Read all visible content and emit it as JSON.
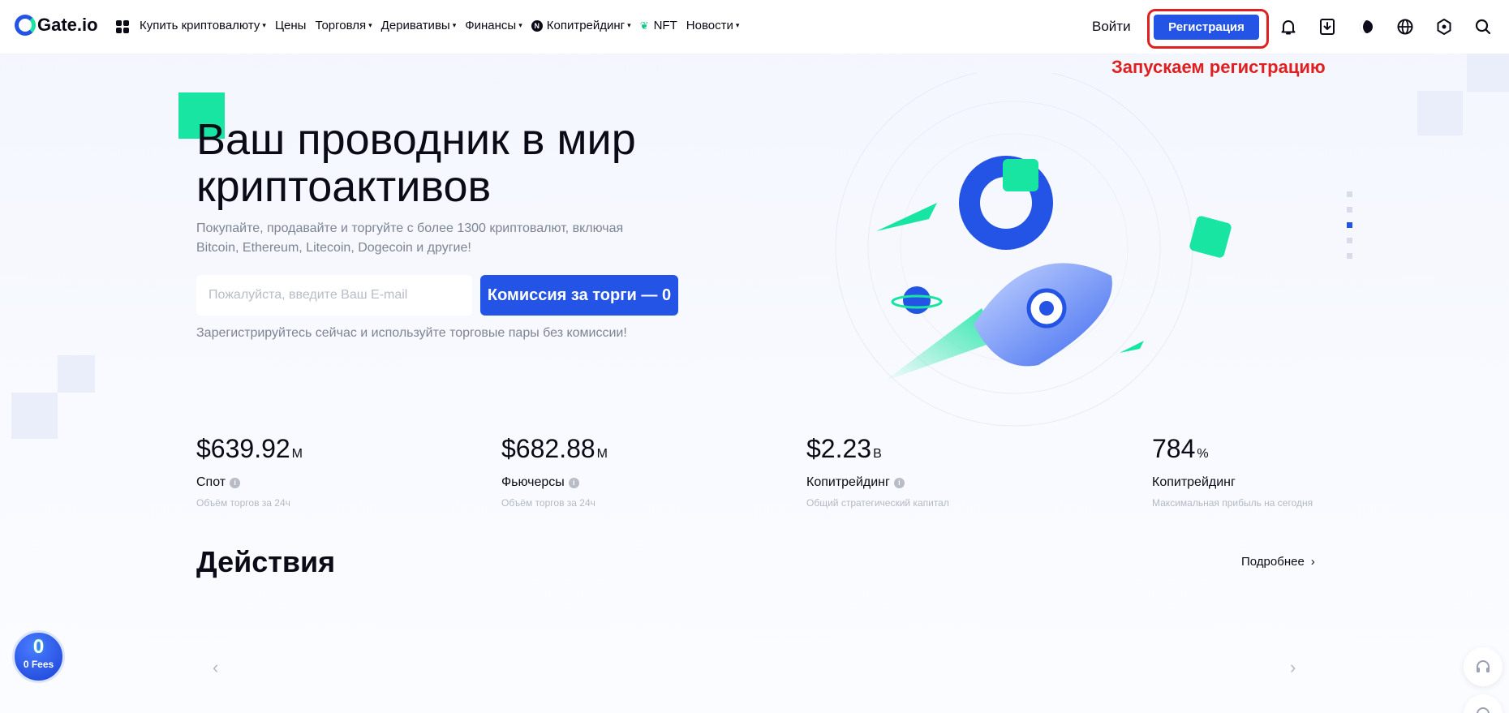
{
  "nav": {
    "logo": "Gate.io",
    "menu": [
      {
        "label": "Купить криптовалюту",
        "dropdown": true
      },
      {
        "label": "Цены",
        "dropdown": false
      },
      {
        "label": "Торговля",
        "dropdown": true
      },
      {
        "label": "Деривативы",
        "dropdown": true
      },
      {
        "label": "Финансы",
        "dropdown": true
      },
      {
        "label": "Копитрейдинг",
        "dropdown": true,
        "icon": "copy-trading-icon"
      },
      {
        "label": "NFT",
        "dropdown": false,
        "icon": "leaf-icon"
      },
      {
        "label": "Новости",
        "dropdown": true
      }
    ],
    "caret": "▾",
    "login": "Войти",
    "register": "Регистрация",
    "icons": [
      "bell-icon",
      "download-icon",
      "theme-icon",
      "globe-icon",
      "settings-icon",
      "search-icon"
    ]
  },
  "annotation": "Запускаем регистрацию",
  "hero": {
    "title": "Ваш проводник в мир криптоактивов",
    "subtitle": "Покупайте, продавайте и торгуйте с более 1300 криптовалют, включая Bitcoin, Ethereum, Litecoin, Dogecoin и другие!",
    "email_placeholder": "Пожалуйста, введите Ваш E-mail",
    "cta": "Комиссия за торги — 0",
    "note": "Зарегистрируйтесь сейчас и используйте торговые пары без комиссии!"
  },
  "stats": [
    {
      "value": "$639.92",
      "unit": "M",
      "label": "Спот",
      "info": true,
      "desc": "Объём торгов за 24ч"
    },
    {
      "value": "$682.88",
      "unit": "M",
      "label": "Фьючерсы",
      "info": true,
      "desc": "Объём торгов за 24ч"
    },
    {
      "value": "$2.23",
      "unit": "B",
      "label": "Копитрейдинг",
      "info": true,
      "desc": "Общий стратегический капитал"
    },
    {
      "value": "784",
      "unit": "%",
      "label": "Копитрейдинг",
      "info": false,
      "desc": "Максимальная прибыль на сегодня"
    }
  ],
  "info_glyph": "i",
  "actions": {
    "title": "Действия",
    "more": "Подробнее",
    "more_arrow": "›",
    "prev": "‹",
    "next": "›"
  },
  "fees_badge": {
    "zero": "0",
    "text": "0 Fees"
  },
  "colors": {
    "brand_blue": "#2354e6",
    "brand_green": "#17e5a1",
    "annotation_red": "#e02020"
  },
  "carousel": {
    "slides": 5,
    "active": 2
  }
}
